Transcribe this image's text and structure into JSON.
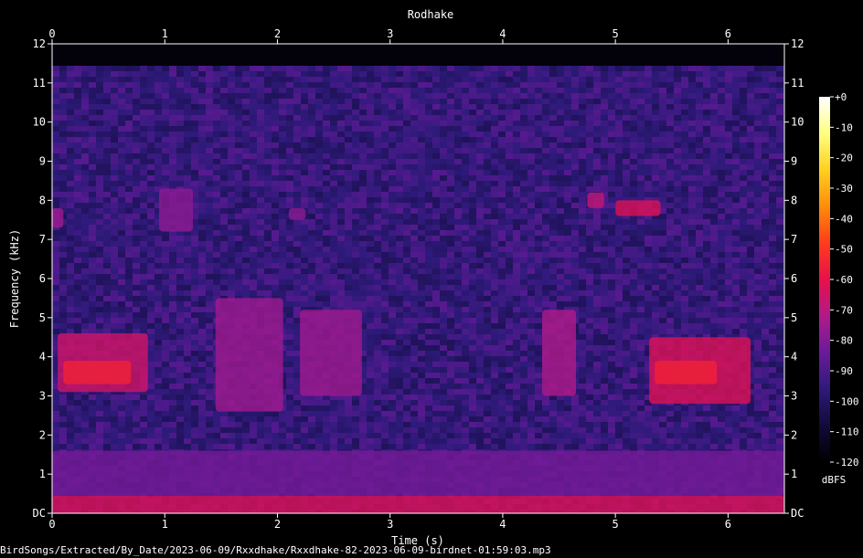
{
  "chart_data": {
    "type": "heatmap",
    "title": "Rodhake",
    "xlabel": "Time (s)",
    "ylabel": "Frequency (kHz)",
    "xlim": [
      0,
      6.5
    ],
    "ylim": [
      0,
      12
    ],
    "x_ticks": [
      "0",
      "1",
      "2",
      "3",
      "4",
      "5",
      "6"
    ],
    "y_ticks": [
      "DC",
      "1",
      "2",
      "3",
      "4",
      "5",
      "6",
      "7",
      "8",
      "9",
      "10",
      "11",
      "12"
    ],
    "colorbar": {
      "label": "dBFS",
      "ticks": [
        "+0",
        "-10",
        "-20",
        "-30",
        "-40",
        "-50",
        "-60",
        "-70",
        "-80",
        "-90",
        "-100",
        "-110",
        "-120"
      ],
      "range": [
        -120,
        0
      ],
      "colors": [
        "#000000",
        "#120a3a",
        "#2e1a7a",
        "#6a1a9a",
        "#b01a8a",
        "#e8104a",
        "#ff3c1a",
        "#ff8c0a",
        "#ffd020",
        "#ffff80",
        "#ffffff"
      ]
    },
    "background_level_dbfs": -95,
    "signal_regions": [
      {
        "t0": 0.05,
        "t1": 0.85,
        "f0": 3.1,
        "f1": 4.6,
        "level": -65
      },
      {
        "t0": 0.1,
        "t1": 0.7,
        "f0": 3.3,
        "f1": 3.9,
        "level": -55
      },
      {
        "t0": 1.45,
        "t1": 2.05,
        "f0": 2.6,
        "f1": 5.5,
        "level": -75
      },
      {
        "t0": 2.2,
        "t1": 2.75,
        "f0": 3.0,
        "f1": 5.2,
        "level": -75
      },
      {
        "t0": 4.35,
        "t1": 4.65,
        "f0": 3.0,
        "f1": 5.2,
        "level": -72
      },
      {
        "t0": 5.3,
        "t1": 6.2,
        "f0": 2.8,
        "f1": 4.5,
        "level": -62
      },
      {
        "t0": 5.35,
        "t1": 5.9,
        "f0": 3.3,
        "f1": 3.9,
        "level": -55
      },
      {
        "t0": 0.0,
        "t1": 0.1,
        "f0": 7.3,
        "f1": 7.8,
        "level": -75
      },
      {
        "t0": 0.95,
        "t1": 1.25,
        "f0": 7.2,
        "f1": 8.3,
        "level": -78
      },
      {
        "t0": 2.1,
        "t1": 2.25,
        "f0": 7.5,
        "f1": 7.8,
        "level": -78
      },
      {
        "t0": 4.75,
        "t1": 4.9,
        "f0": 7.8,
        "f1": 8.2,
        "level": -68
      },
      {
        "t0": 5.0,
        "t1": 5.4,
        "f0": 7.6,
        "f1": 8.0,
        "level": -62
      },
      {
        "t0": 0.0,
        "t1": 6.5,
        "f0": 0.0,
        "f1": 0.45,
        "level": -62
      },
      {
        "t0": 0.0,
        "t1": 6.5,
        "f0": 0.45,
        "f1": 1.6,
        "level": -82
      }
    ]
  },
  "footer": {
    "path": "BirdSongs/Extracted/By_Date/2023-06-09/Rxxdhake/Rxxdhake-82-2023-06-09-birdnet-01:59:03.mp3"
  }
}
